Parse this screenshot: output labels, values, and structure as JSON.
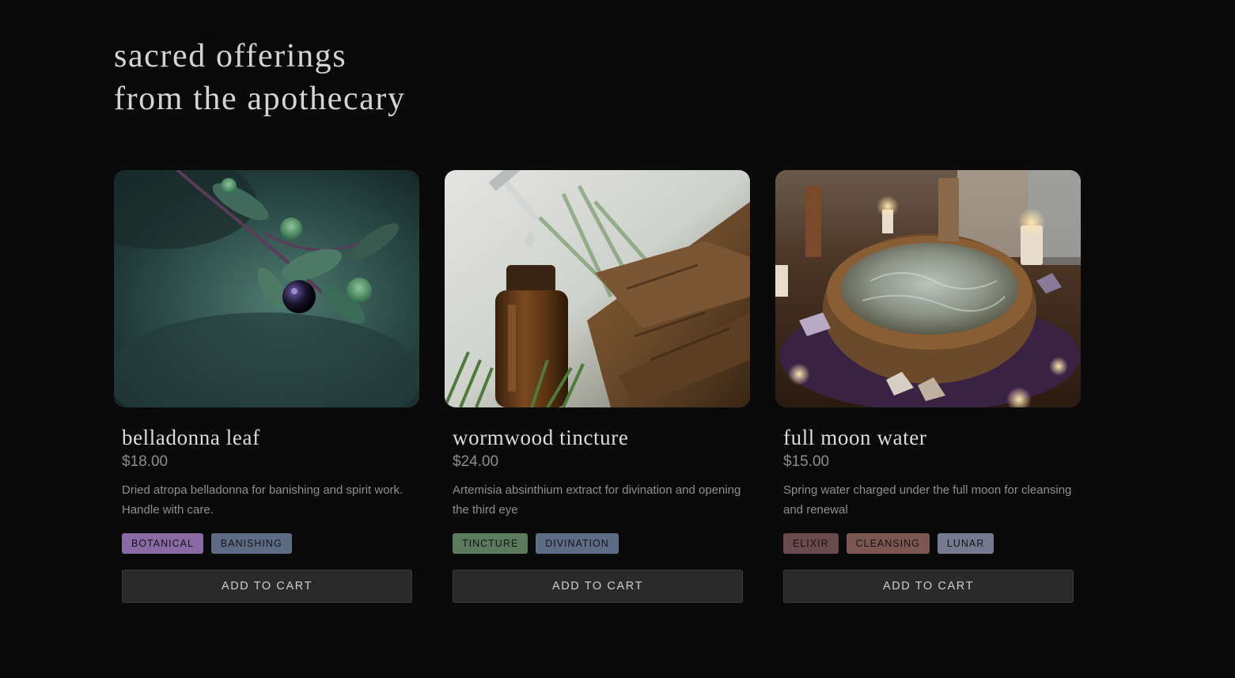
{
  "heading": {
    "line1": "sacred offerings",
    "line2": "from the apothecary"
  },
  "products": [
    {
      "name": "belladonna leaf",
      "price": "$18.00",
      "description": "Dried atropa belladonna for banishing and spirit work. Handle with care.",
      "image": "belladonna-berry-photo",
      "tags": [
        {
          "label": "BOTANICAL",
          "color": "#8a6aa4"
        },
        {
          "label": "BANISHING",
          "color": "#5d6b85"
        }
      ],
      "button_label": "ADD TO CART"
    },
    {
      "name": "wormwood tincture",
      "price": "$24.00",
      "description": "Artemisia absinthium extract for divination and opening the third eye",
      "image": "tincture-bottle-photo",
      "tags": [
        {
          "label": "TINCTURE",
          "color": "#5b7a5e"
        },
        {
          "label": "DIVINATION",
          "color": "#5d6b85"
        }
      ],
      "button_label": "ADD TO CART"
    },
    {
      "name": "full moon water",
      "price": "$15.00",
      "description": "Spring water charged under the full moon for cleansing and renewal",
      "image": "moon-water-bowl-photo",
      "tags": [
        {
          "label": "ELIXIR",
          "color": "#6b4a4e"
        },
        {
          "label": "CLEANSING",
          "color": "#7c5650"
        },
        {
          "label": "LUNAR",
          "color": "#767a91"
        }
      ],
      "button_label": "ADD TO CART"
    }
  ]
}
